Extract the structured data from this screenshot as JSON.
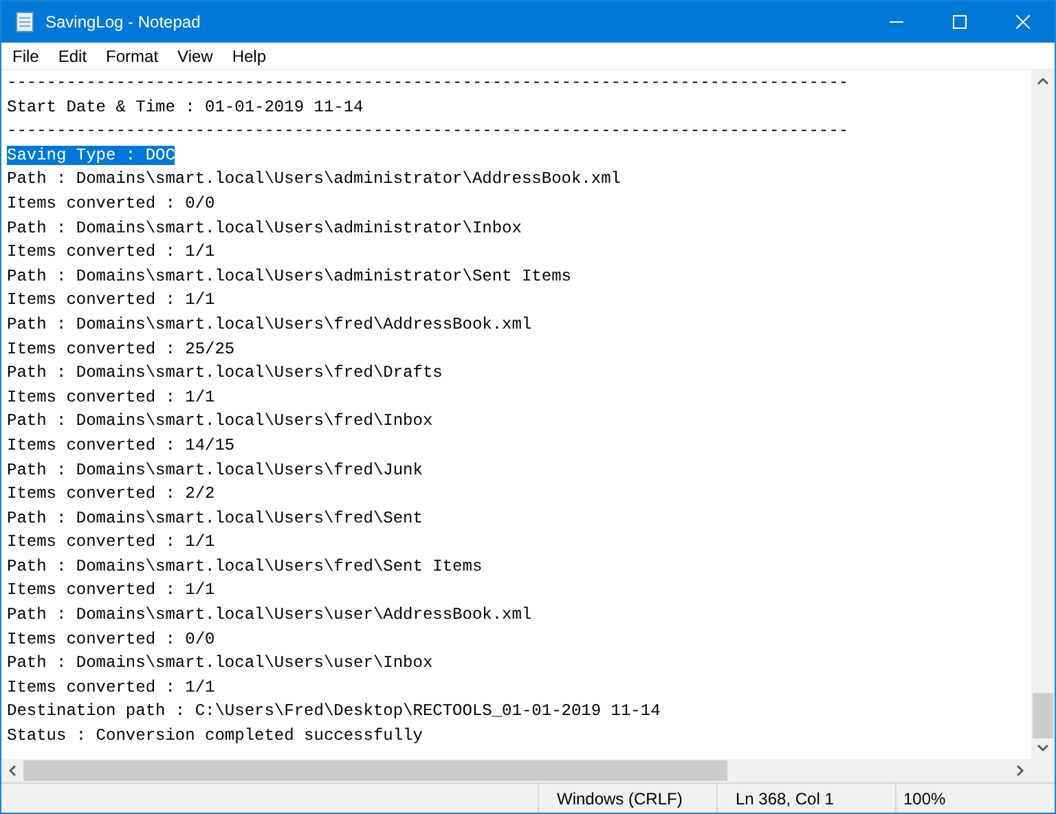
{
  "window": {
    "title": "SavingLog - Notepad"
  },
  "menu": [
    "File",
    "Edit",
    "Format",
    "View",
    "Help"
  ],
  "lines": [
    {
      "text": "-------------------------------------------------------------------------------------",
      "selected": false
    },
    {
      "text": "Start Date & Time : 01-01-2019 11-14",
      "selected": false
    },
    {
      "text": "-------------------------------------------------------------------------------------",
      "selected": false
    },
    {
      "text": "Saving Type : DOC",
      "selected": true
    },
    {
      "text": "Path : Domains\\smart.local\\Users\\administrator\\AddressBook.xml",
      "selected": false
    },
    {
      "text": "Items converted : 0/0",
      "selected": false
    },
    {
      "text": "Path : Domains\\smart.local\\Users\\administrator\\Inbox",
      "selected": false
    },
    {
      "text": "Items converted : 1/1",
      "selected": false
    },
    {
      "text": "Path : Domains\\smart.local\\Users\\administrator\\Sent Items",
      "selected": false
    },
    {
      "text": "Items converted : 1/1",
      "selected": false
    },
    {
      "text": "Path : Domains\\smart.local\\Users\\fred\\AddressBook.xml",
      "selected": false
    },
    {
      "text": "Items converted : 25/25",
      "selected": false
    },
    {
      "text": "Path : Domains\\smart.local\\Users\\fred\\Drafts",
      "selected": false
    },
    {
      "text": "Items converted : 1/1",
      "selected": false
    },
    {
      "text": "Path : Domains\\smart.local\\Users\\fred\\Inbox",
      "selected": false
    },
    {
      "text": "Items converted : 14/15",
      "selected": false
    },
    {
      "text": "Path : Domains\\smart.local\\Users\\fred\\Junk",
      "selected": false
    },
    {
      "text": "Items converted : 2/2",
      "selected": false
    },
    {
      "text": "Path : Domains\\smart.local\\Users\\fred\\Sent",
      "selected": false
    },
    {
      "text": "Items converted : 1/1",
      "selected": false
    },
    {
      "text": "Path : Domains\\smart.local\\Users\\fred\\Sent Items",
      "selected": false
    },
    {
      "text": "Items converted : 1/1",
      "selected": false
    },
    {
      "text": "Path : Domains\\smart.local\\Users\\user\\AddressBook.xml",
      "selected": false
    },
    {
      "text": "Items converted : 0/0",
      "selected": false
    },
    {
      "text": "Path : Domains\\smart.local\\Users\\user\\Inbox",
      "selected": false
    },
    {
      "text": "Items converted : 1/1",
      "selected": false
    },
    {
      "text": "Destination path : C:\\Users\\Fred\\Desktop\\RECTOOLS_01-01-2019 11-14",
      "selected": false
    },
    {
      "text": "Status : Conversion completed successfully",
      "selected": false
    }
  ],
  "status_bar": {
    "line_ending": "Windows (CRLF)",
    "position": "Ln 368, Col 1",
    "zoom": "100%"
  }
}
